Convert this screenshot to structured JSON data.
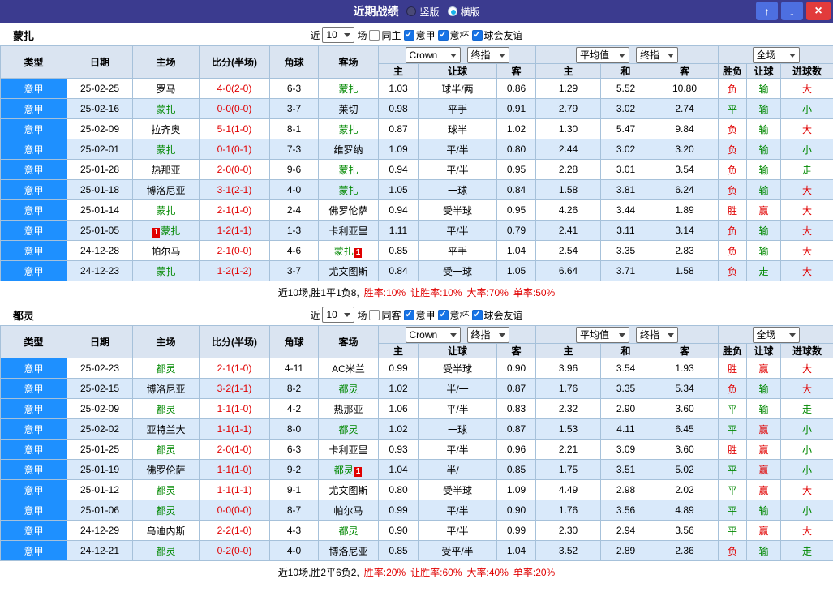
{
  "titlebar": {
    "title": "近期战绩",
    "radios": [
      {
        "label": "竖版",
        "selected": false
      },
      {
        "label": "横版",
        "selected": true
      }
    ],
    "buttons": {
      "up": "↑",
      "down": "↓",
      "close": "×"
    }
  },
  "table_header": {
    "left": [
      "类型",
      "日期",
      "主场",
      "比分(半场)",
      "角球",
      "客场"
    ],
    "asian": [
      "主",
      "让球",
      "客"
    ],
    "euro": [
      "主",
      "和",
      "客"
    ],
    "result": [
      "胜负",
      "让球",
      "进球数"
    ]
  },
  "sections": [
    {
      "team": "蒙扎",
      "filter": {
        "near_label": "近",
        "count": "10",
        "matches_label": "场",
        "same_label": "同主",
        "same_checked": false,
        "leagues": [
          {
            "label": "意甲",
            "checked": true
          },
          {
            "label": "意杯",
            "checked": true
          },
          {
            "label": "球会友谊",
            "checked": true
          }
        ]
      },
      "dropdowns": {
        "company": "Crown",
        "asian_stage": "终指",
        "euro_avg": "平均值",
        "euro_stage": "终指",
        "scope": "全场"
      },
      "rows": [
        {
          "lg": "意甲",
          "dt": "25-02-25",
          "hm": "罗马",
          "hg": false,
          "hb": "",
          "hbp": "",
          "sc": "4-0(2-0)",
          "cn": "6-3",
          "aw": "蒙扎",
          "ag": true,
          "ab": "",
          "abp": "",
          "a1": "1.03",
          "ah": "球半/两",
          "a2": "0.86",
          "e1": "1.29",
          "e2": "5.52",
          "e3": "10.80",
          "r1": "负",
          "c1": "red",
          "r2": "输",
          "c2": "green",
          "r3": "大",
          "c3": "red"
        },
        {
          "lg": "意甲",
          "dt": "25-02-16",
          "hm": "蒙扎",
          "hg": true,
          "hb": "",
          "hbp": "",
          "sc": "0-0(0-0)",
          "cn": "3-7",
          "aw": "莱切",
          "ag": false,
          "ab": "",
          "abp": "",
          "a1": "0.98",
          "ah": "平手",
          "a2": "0.91",
          "e1": "2.79",
          "e2": "3.02",
          "e3": "2.74",
          "r1": "平",
          "c1": "green",
          "r2": "输",
          "c2": "green",
          "r3": "小",
          "c3": "green"
        },
        {
          "lg": "意甲",
          "dt": "25-02-09",
          "hm": "拉齐奥",
          "hg": false,
          "hb": "",
          "hbp": "",
          "sc": "5-1(1-0)",
          "cn": "8-1",
          "aw": "蒙扎",
          "ag": true,
          "ab": "",
          "abp": "",
          "a1": "0.87",
          "ah": "球半",
          "a2": "1.02",
          "e1": "1.30",
          "e2": "5.47",
          "e3": "9.84",
          "r1": "负",
          "c1": "red",
          "r2": "输",
          "c2": "green",
          "r3": "大",
          "c3": "red"
        },
        {
          "lg": "意甲",
          "dt": "25-02-01",
          "hm": "蒙扎",
          "hg": true,
          "hb": "",
          "hbp": "",
          "sc": "0-1(0-1)",
          "cn": "7-3",
          "aw": "维罗纳",
          "ag": false,
          "ab": "",
          "abp": "",
          "a1": "1.09",
          "ah": "平/半",
          "a2": "0.80",
          "e1": "2.44",
          "e2": "3.02",
          "e3": "3.20",
          "r1": "负",
          "c1": "red",
          "r2": "输",
          "c2": "green",
          "r3": "小",
          "c3": "green"
        },
        {
          "lg": "意甲",
          "dt": "25-01-28",
          "hm": "热那亚",
          "hg": false,
          "hb": "",
          "hbp": "",
          "sc": "2-0(0-0)",
          "cn": "9-6",
          "aw": "蒙扎",
          "ag": true,
          "ab": "",
          "abp": "",
          "a1": "0.94",
          "ah": "平/半",
          "a2": "0.95",
          "e1": "2.28",
          "e2": "3.01",
          "e3": "3.54",
          "r1": "负",
          "c1": "red",
          "r2": "输",
          "c2": "green",
          "r3": "走",
          "c3": "green"
        },
        {
          "lg": "意甲",
          "dt": "25-01-18",
          "hm": "博洛尼亚",
          "hg": false,
          "hb": "",
          "hbp": "",
          "sc": "3-1(2-1)",
          "cn": "4-0",
          "aw": "蒙扎",
          "ag": true,
          "ab": "",
          "abp": "",
          "a1": "1.05",
          "ah": "一球",
          "a2": "0.84",
          "e1": "1.58",
          "e2": "3.81",
          "e3": "6.24",
          "r1": "负",
          "c1": "red",
          "r2": "输",
          "c2": "green",
          "r3": "大",
          "c3": "red"
        },
        {
          "lg": "意甲",
          "dt": "25-01-14",
          "hm": "蒙扎",
          "hg": true,
          "hb": "",
          "hbp": "",
          "sc": "2-1(1-0)",
          "cn": "2-4",
          "aw": "佛罗伦萨",
          "ag": false,
          "ab": "",
          "abp": "",
          "a1": "0.94",
          "ah": "受半球",
          "a2": "0.95",
          "e1": "4.26",
          "e2": "3.44",
          "e3": "1.89",
          "r1": "胜",
          "c1": "red",
          "r2": "赢",
          "c2": "red",
          "r3": "大",
          "c3": "red"
        },
        {
          "lg": "意甲",
          "dt": "25-01-05",
          "hm": "蒙扎",
          "hg": true,
          "hb": "1",
          "hbp": "before",
          "sc": "1-2(1-1)",
          "cn": "1-3",
          "aw": "卡利亚里",
          "ag": false,
          "ab": "",
          "abp": "",
          "a1": "1.11",
          "ah": "平/半",
          "a2": "0.79",
          "e1": "2.41",
          "e2": "3.11",
          "e3": "3.14",
          "r1": "负",
          "c1": "red",
          "r2": "输",
          "c2": "green",
          "r3": "大",
          "c3": "red"
        },
        {
          "lg": "意甲",
          "dt": "24-12-28",
          "hm": "帕尔马",
          "hg": false,
          "hb": "",
          "hbp": "",
          "sc": "2-1(0-0)",
          "cn": "4-6",
          "aw": "蒙扎",
          "ag": true,
          "ab": "1",
          "abp": "after",
          "a1": "0.85",
          "ah": "平手",
          "a2": "1.04",
          "e1": "2.54",
          "e2": "3.35",
          "e3": "2.83",
          "r1": "负",
          "c1": "red",
          "r2": "输",
          "c2": "green",
          "r3": "大",
          "c3": "red"
        },
        {
          "lg": "意甲",
          "dt": "24-12-23",
          "hm": "蒙扎",
          "hg": true,
          "hb": "",
          "hbp": "",
          "sc": "1-2(1-2)",
          "cn": "3-7",
          "aw": "尤文图斯",
          "ag": false,
          "ab": "",
          "abp": "",
          "a1": "0.84",
          "ah": "受一球",
          "a2": "1.05",
          "e1": "6.64",
          "e2": "3.71",
          "e3": "1.58",
          "r1": "负",
          "c1": "red",
          "r2": "走",
          "c2": "green",
          "r3": "大",
          "c3": "red"
        }
      ],
      "summary": {
        "prefix": "近10场,胜1平1负8,",
        "stats": [
          "胜率:10%",
          "让胜率:10%",
          "大率:70%",
          "单率:50%"
        ]
      }
    },
    {
      "team": "都灵",
      "filter": {
        "near_label": "近",
        "count": "10",
        "matches_label": "场",
        "same_label": "同客",
        "same_checked": false,
        "leagues": [
          {
            "label": "意甲",
            "checked": true
          },
          {
            "label": "意杯",
            "checked": true
          },
          {
            "label": "球会友谊",
            "checked": true
          }
        ]
      },
      "dropdowns": {
        "company": "Crown",
        "asian_stage": "终指",
        "euro_avg": "平均值",
        "euro_stage": "终指",
        "scope": "全场"
      },
      "rows": [
        {
          "lg": "意甲",
          "dt": "25-02-23",
          "hm": "都灵",
          "hg": true,
          "hb": "",
          "hbp": "",
          "sc": "2-1(1-0)",
          "cn": "4-11",
          "aw": "AC米兰",
          "ag": false,
          "ab": "",
          "abp": "",
          "a1": "0.99",
          "ah": "受半球",
          "a2": "0.90",
          "e1": "3.96",
          "e2": "3.54",
          "e3": "1.93",
          "r1": "胜",
          "c1": "red",
          "r2": "赢",
          "c2": "red",
          "r3": "大",
          "c3": "red"
        },
        {
          "lg": "意甲",
          "dt": "25-02-15",
          "hm": "博洛尼亚",
          "hg": false,
          "hb": "",
          "hbp": "",
          "sc": "3-2(1-1)",
          "cn": "8-2",
          "aw": "都灵",
          "ag": true,
          "ab": "",
          "abp": "",
          "a1": "1.02",
          "ah": "半/一",
          "a2": "0.87",
          "e1": "1.76",
          "e2": "3.35",
          "e3": "5.34",
          "r1": "负",
          "c1": "red",
          "r2": "输",
          "c2": "green",
          "r3": "大",
          "c3": "red"
        },
        {
          "lg": "意甲",
          "dt": "25-02-09",
          "hm": "都灵",
          "hg": true,
          "hb": "",
          "hbp": "",
          "sc": "1-1(1-0)",
          "cn": "4-2",
          "aw": "热那亚",
          "ag": false,
          "ab": "",
          "abp": "",
          "a1": "1.06",
          "ah": "平/半",
          "a2": "0.83",
          "e1": "2.32",
          "e2": "2.90",
          "e3": "3.60",
          "r1": "平",
          "c1": "green",
          "r2": "输",
          "c2": "green",
          "r3": "走",
          "c3": "green"
        },
        {
          "lg": "意甲",
          "dt": "25-02-02",
          "hm": "亚特兰大",
          "hg": false,
          "hb": "",
          "hbp": "",
          "sc": "1-1(1-1)",
          "cn": "8-0",
          "aw": "都灵",
          "ag": true,
          "ab": "",
          "abp": "",
          "a1": "1.02",
          "ah": "一球",
          "a2": "0.87",
          "e1": "1.53",
          "e2": "4.11",
          "e3": "6.45",
          "r1": "平",
          "c1": "green",
          "r2": "赢",
          "c2": "red",
          "r3": "小",
          "c3": "green"
        },
        {
          "lg": "意甲",
          "dt": "25-01-25",
          "hm": "都灵",
          "hg": true,
          "hb": "",
          "hbp": "",
          "sc": "2-0(1-0)",
          "cn": "6-3",
          "aw": "卡利亚里",
          "ag": false,
          "ab": "",
          "abp": "",
          "a1": "0.93",
          "ah": "平/半",
          "a2": "0.96",
          "e1": "2.21",
          "e2": "3.09",
          "e3": "3.60",
          "r1": "胜",
          "c1": "red",
          "r2": "赢",
          "c2": "red",
          "r3": "小",
          "c3": "green"
        },
        {
          "lg": "意甲",
          "dt": "25-01-19",
          "hm": "佛罗伦萨",
          "hg": false,
          "hb": "",
          "hbp": "",
          "sc": "1-1(1-0)",
          "cn": "9-2",
          "aw": "都灵",
          "ag": true,
          "ab": "1",
          "abp": "after",
          "a1": "1.04",
          "ah": "半/一",
          "a2": "0.85",
          "e1": "1.75",
          "e2": "3.51",
          "e3": "5.02",
          "r1": "平",
          "c1": "green",
          "r2": "赢",
          "c2": "red",
          "r3": "小",
          "c3": "green"
        },
        {
          "lg": "意甲",
          "dt": "25-01-12",
          "hm": "都灵",
          "hg": true,
          "hb": "",
          "hbp": "",
          "sc": "1-1(1-1)",
          "cn": "9-1",
          "aw": "尤文图斯",
          "ag": false,
          "ab": "",
          "abp": "",
          "a1": "0.80",
          "ah": "受半球",
          "a2": "1.09",
          "e1": "4.49",
          "e2": "2.98",
          "e3": "2.02",
          "r1": "平",
          "c1": "green",
          "r2": "赢",
          "c2": "red",
          "r3": "大",
          "c3": "red"
        },
        {
          "lg": "意甲",
          "dt": "25-01-06",
          "hm": "都灵",
          "hg": true,
          "hb": "",
          "hbp": "",
          "sc": "0-0(0-0)",
          "cn": "8-7",
          "aw": "帕尔马",
          "ag": false,
          "ab": "",
          "abp": "",
          "a1": "0.99",
          "ah": "平/半",
          "a2": "0.90",
          "e1": "1.76",
          "e2": "3.56",
          "e3": "4.89",
          "r1": "平",
          "c1": "green",
          "r2": "输",
          "c2": "green",
          "r3": "小",
          "c3": "green"
        },
        {
          "lg": "意甲",
          "dt": "24-12-29",
          "hm": "乌迪内斯",
          "hg": false,
          "hb": "",
          "hbp": "",
          "sc": "2-2(1-0)",
          "cn": "4-3",
          "aw": "都灵",
          "ag": true,
          "ab": "",
          "abp": "",
          "a1": "0.90",
          "ah": "平/半",
          "a2": "0.99",
          "e1": "2.30",
          "e2": "2.94",
          "e3": "3.56",
          "r1": "平",
          "c1": "green",
          "r2": "赢",
          "c2": "red",
          "r3": "大",
          "c3": "red"
        },
        {
          "lg": "意甲",
          "dt": "24-12-21",
          "hm": "都灵",
          "hg": true,
          "hb": "",
          "hbp": "",
          "sc": "0-2(0-0)",
          "cn": "4-0",
          "aw": "博洛尼亚",
          "ag": false,
          "ab": "",
          "abp": "",
          "a1": "0.85",
          "ah": "受平/半",
          "a2": "1.04",
          "e1": "3.52",
          "e2": "2.89",
          "e3": "2.36",
          "r1": "负",
          "c1": "red",
          "r2": "输",
          "c2": "green",
          "r3": "走",
          "c3": "green"
        }
      ],
      "summary": {
        "prefix": "近10场,胜2平6负2,",
        "stats": [
          "胜率:20%",
          "让胜率:60%",
          "大率:40%",
          "单率:20%"
        ]
      }
    }
  ]
}
